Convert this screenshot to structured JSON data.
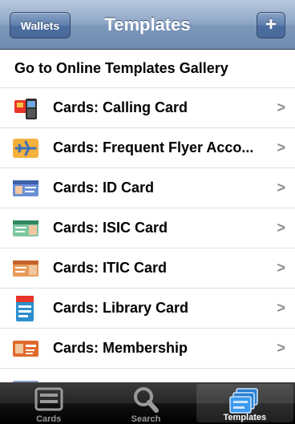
{
  "navbar": {
    "title": "Templates",
    "left_button": "Wallets",
    "right_button": "+"
  },
  "gallery": {
    "label": "Go to Online Templates Gallery"
  },
  "templates": [
    {
      "label": "Cards: Calling Card",
      "icon": "calling-card-icon"
    },
    {
      "label": "Cards: Frequent Flyer Acco...",
      "icon": "airplane-icon"
    },
    {
      "label": "Cards: ID Card",
      "icon": "id-card-icon"
    },
    {
      "label": "Cards: ISIC Card",
      "icon": "isic-card-icon"
    },
    {
      "label": "Cards: ITIC Card",
      "icon": "itic-card-icon"
    },
    {
      "label": "Cards: Library Card",
      "icon": "library-card-icon"
    },
    {
      "label": "Cards: Membership",
      "icon": "membership-card-icon"
    }
  ],
  "tabs": [
    {
      "label": "Cards",
      "icon": "cards-icon",
      "selected": false
    },
    {
      "label": "Search",
      "icon": "magnifier-icon",
      "selected": false
    },
    {
      "label": "Templates",
      "icon": "templates-icon",
      "selected": true
    }
  ],
  "colors": {
    "navbar": "#7d98bb",
    "tabbar": "#1a1a1a",
    "chevron": "#8c8c8c"
  }
}
